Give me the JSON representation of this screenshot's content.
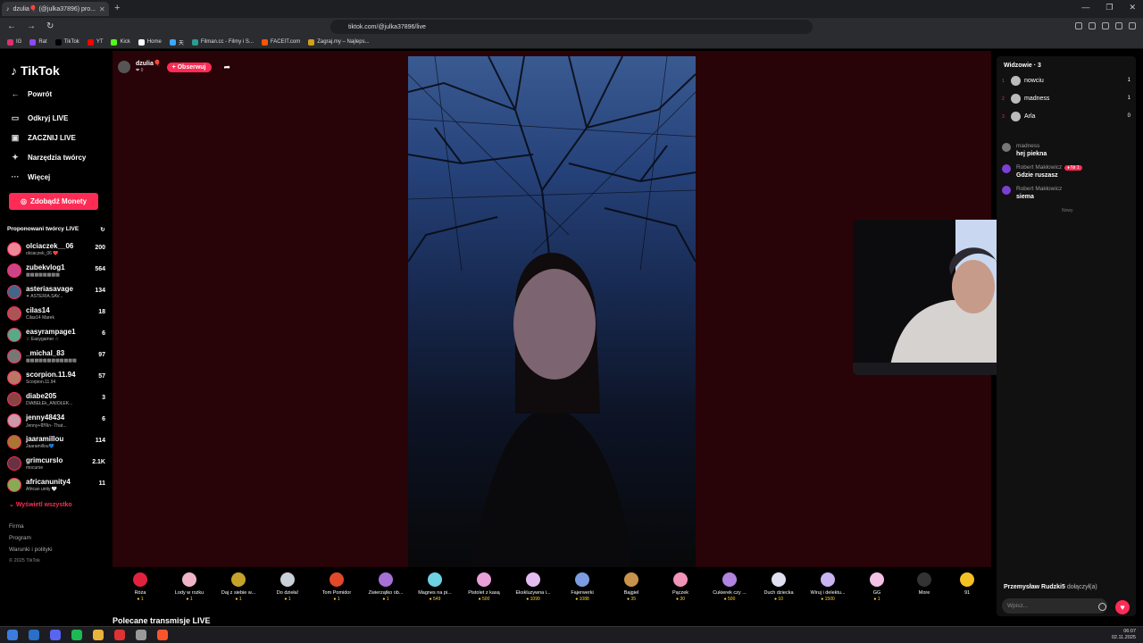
{
  "browser": {
    "tab_title": "dzulia🎈 (@julka37896) pro...",
    "url": "tiktok.com/@julka37896/live",
    "bookmarks": [
      "IG",
      "Rat",
      "TikTok",
      "YT",
      "Kick",
      "Home",
      "天",
      "Filman.cc - Filmy i S...",
      "FACEIT.com",
      "Zagraj.my – Najleps..."
    ]
  },
  "sidebar": {
    "logo": "TikTok",
    "back": "Powrót",
    "nav": [
      "Odkryj LIVE",
      "ZACZNIJ LIVE",
      "Narzędzia twórcy",
      "Więcej"
    ],
    "coins_button": "Zdobądź Monety",
    "suggested_title": "Proponowani twórcy LIVE",
    "creators": [
      {
        "name": "olciaczek__06",
        "sub": "olciaczek_06 ❤️",
        "count": "200"
      },
      {
        "name": "zubekvlog1",
        "sub": "▩▩▩▩▩▩▩▩",
        "count": "564"
      },
      {
        "name": "asteriasavage",
        "sub": "✦ ASTERIA.SAV...",
        "count": "134"
      },
      {
        "name": "cilas14",
        "sub": "Cilas14 Marek",
        "count": "18"
      },
      {
        "name": "easyrampage1",
        "sub": "☆ Easygamer ☆",
        "count": "6"
      },
      {
        "name": "_michal_83",
        "sub": "▩▩▩▩▩▩▩▩▩▩▩▩",
        "count": "97"
      },
      {
        "name": "scorpion.11.94",
        "sub": "Scorpion.11.94",
        "count": "57"
      },
      {
        "name": "diabe205",
        "sub": "DIABEŁEk_ANIOŁEK...",
        "count": "3"
      },
      {
        "name": "jenny48434",
        "sub": "Jenny+จีกิจิก- That...",
        "count": "6"
      },
      {
        "name": "jaaramillou",
        "sub": "Jaaramillou💙",
        "count": "114"
      },
      {
        "name": "grimcurslo",
        "sub": "mocurse",
        "count": "2.1K"
      },
      {
        "name": "africanunity4",
        "sub": "African unity 🤍",
        "count": "11"
      }
    ],
    "show_all": "Wyświetl wszystko",
    "footer": [
      "Firma",
      "Program",
      "Warunki i polityki"
    ],
    "copyright": "© 2025 TikTok"
  },
  "stream": {
    "streamer_name": "dzulia🎈",
    "streamer_sub": "❤ 0",
    "follow": "+ Obserwuj"
  },
  "gifts": [
    {
      "name": "Róża",
      "price": "1",
      "color": "#e0223f"
    },
    {
      "name": "Lody w rożku",
      "price": "1",
      "color": "#f1b4c7"
    },
    {
      "name": "Daj z siebie w...",
      "price": "1",
      "color": "#c6a22b"
    },
    {
      "name": "Do dzieła!",
      "price": "1",
      "color": "#c9d0d9"
    },
    {
      "name": "Tom Pomidor",
      "price": "1",
      "color": "#e04a2a"
    },
    {
      "name": "Zwierzątko ob...",
      "price": "1",
      "color": "#a770d6"
    },
    {
      "name": "Magnes na pi...",
      "price": "549",
      "color": "#6fd1e4"
    },
    {
      "name": "Pistolet z kasą",
      "price": "500",
      "color": "#e8a1d8"
    },
    {
      "name": "Ekskluzywna i...",
      "price": "1099",
      "color": "#e3bdf2"
    },
    {
      "name": "Fajerwerki",
      "price": "1088",
      "color": "#7c9be0"
    },
    {
      "name": "Bajgiel",
      "price": "35",
      "color": "#c8934a"
    },
    {
      "name": "Pączek",
      "price": "30",
      "color": "#f293b8"
    },
    {
      "name": "Cukierek czy ...",
      "price": "500",
      "color": "#b184e0"
    },
    {
      "name": "Duch dziecka",
      "price": "10",
      "color": "#e0e0f0"
    },
    {
      "name": "Wiruj i delektu...",
      "price": "1500",
      "color": "#c7b4f0"
    },
    {
      "name": "GG",
      "price": "1",
      "color": "#f3c1e6"
    }
  ],
  "gifts_more": "More",
  "coins_balance": "91",
  "recommended": "Polecane transmisje LIVE",
  "right_panel": {
    "viewers_title": "Widzowie · 3",
    "viewers": [
      {
        "rank": "1",
        "name": "nowciu",
        "count": "1"
      },
      {
        "rank": "2",
        "name": "madness",
        "count": "1"
      },
      {
        "rank": "3",
        "name": "Arla",
        "count": "0"
      }
    ],
    "messages": [
      {
        "user": "madness",
        "text": "hej piekna",
        "badge": ""
      },
      {
        "user": "Robert Makłowicz",
        "text": "Gdzie ruszasz",
        "badge": "♦ Nr 1"
      },
      {
        "user": "Robert Makłowicz",
        "text": "siema",
        "badge": ""
      }
    ],
    "new_label": "Nowy",
    "joined_user": "Przemysław Rudzki5",
    "joined_text": "dołączył(a)",
    "input_placeholder": "Wpisz..."
  },
  "taskbar": {
    "time": "06:07",
    "date": "02.11.2025"
  }
}
